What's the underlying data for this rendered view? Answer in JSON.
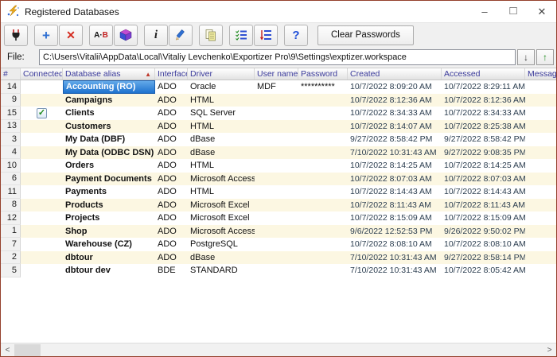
{
  "window": {
    "title": "Registered Databases"
  },
  "icons": {
    "minimize": "–",
    "maximize": "□",
    "close": "✕",
    "plus": "+",
    "delete": "✕",
    "rename_a": "A·",
    "rename_b": "B",
    "info": "i",
    "help": "?",
    "down_arrow": "↓",
    "up_arrow": "↑",
    "scroll_left": "<",
    "scroll_right": ">",
    "sort_ascending": "▲",
    "check": "✓"
  },
  "toolbar": {
    "buttons": [
      {
        "id": "connect",
        "icon": "plug-icon"
      },
      {
        "id": "add",
        "icon": "plus-icon"
      },
      {
        "id": "delete",
        "icon": "delete-x-icon"
      },
      {
        "id": "rename",
        "icon": "rename-ab-icon"
      },
      {
        "id": "database-properties",
        "icon": "database-cube-icon"
      },
      {
        "id": "info",
        "icon": "info-icon"
      },
      {
        "id": "edit",
        "icon": "pencil-icon"
      },
      {
        "id": "copy",
        "icon": "copy-icon"
      },
      {
        "id": "check-list",
        "icon": "checklist-icon"
      },
      {
        "id": "reorder-list",
        "icon": "reorder-icon"
      },
      {
        "id": "help",
        "icon": "help-icon"
      }
    ],
    "clear_passwords_label": "Clear Passwords"
  },
  "file_bar": {
    "label": "File:",
    "path": "C:\\Users\\Vitalii\\AppData\\Local\\Vitaliy Levchenko\\Exportizer Pro\\9\\Settings\\exptizer.workspace"
  },
  "table": {
    "columns": [
      "#",
      "Connected",
      "Database alias",
      "Interface",
      "Driver",
      "User name",
      "Password",
      "Created",
      "Accessed",
      "Message"
    ],
    "sort": {
      "column": "Database alias",
      "direction": "ascending"
    },
    "rows": [
      {
        "num": "14",
        "connected": false,
        "alias": "Accounting (RO)",
        "interface": "ADO",
        "driver": "Oracle",
        "user": "MDF",
        "password": "**********",
        "created": "10/7/2022 8:09:20 AM",
        "accessed": "10/7/2022 8:29:11 AM",
        "message": "",
        "selected": true
      },
      {
        "num": "9",
        "connected": false,
        "alias": "Campaigns",
        "interface": "ADO",
        "driver": "HTML",
        "user": "",
        "password": "",
        "created": "10/7/2022 8:12:36 AM",
        "accessed": "10/7/2022 8:12:36 AM",
        "message": "",
        "selected": false
      },
      {
        "num": "15",
        "connected": true,
        "alias": "Clients",
        "interface": "ADO",
        "driver": "SQL Server",
        "user": "",
        "password": "",
        "created": "10/7/2022 8:34:33 AM",
        "accessed": "10/7/2022 8:34:33 AM",
        "message": "",
        "selected": false
      },
      {
        "num": "13",
        "connected": false,
        "alias": "Customers",
        "interface": "ADO",
        "driver": "HTML",
        "user": "",
        "password": "",
        "created": "10/7/2022 8:14:07 AM",
        "accessed": "10/7/2022 8:25:38 AM",
        "message": "",
        "selected": false
      },
      {
        "num": "3",
        "connected": false,
        "alias": "My Data (DBF)",
        "interface": "ADO",
        "driver": "dBase",
        "user": "",
        "password": "",
        "created": "9/27/2022 8:58:42 PM",
        "accessed": "9/27/2022 8:58:42 PM",
        "message": "",
        "selected": false
      },
      {
        "num": "4",
        "connected": false,
        "alias": "My Data (ODBC DSN)",
        "interface": "ADO",
        "driver": "dBase",
        "user": "",
        "password": "",
        "created": "7/10/2022 10:31:43 AM",
        "accessed": "9/27/2022 9:08:35 PM",
        "message": "",
        "selected": false
      },
      {
        "num": "10",
        "connected": false,
        "alias": "Orders",
        "interface": "ADO",
        "driver": "HTML",
        "user": "",
        "password": "",
        "created": "10/7/2022 8:14:25 AM",
        "accessed": "10/7/2022 8:14:25 AM",
        "message": "",
        "selected": false
      },
      {
        "num": "6",
        "connected": false,
        "alias": "Payment Documents",
        "interface": "ADO",
        "driver": "Microsoft Access",
        "user": "",
        "password": "",
        "created": "10/7/2022 8:07:03 AM",
        "accessed": "10/7/2022 8:07:03 AM",
        "message": "",
        "selected": false
      },
      {
        "num": "11",
        "connected": false,
        "alias": "Payments",
        "interface": "ADO",
        "driver": "HTML",
        "user": "",
        "password": "",
        "created": "10/7/2022 8:14:43 AM",
        "accessed": "10/7/2022 8:14:43 AM",
        "message": "",
        "selected": false
      },
      {
        "num": "8",
        "connected": false,
        "alias": "Products",
        "interface": "ADO",
        "driver": "Microsoft Excel",
        "user": "",
        "password": "",
        "created": "10/7/2022 8:11:43 AM",
        "accessed": "10/7/2022 8:11:43 AM",
        "message": "",
        "selected": false
      },
      {
        "num": "12",
        "connected": false,
        "alias": "Projects",
        "interface": "ADO",
        "driver": "Microsoft Excel",
        "user": "",
        "password": "",
        "created": "10/7/2022 8:15:09 AM",
        "accessed": "10/7/2022 8:15:09 AM",
        "message": "",
        "selected": false
      },
      {
        "num": "1",
        "connected": false,
        "alias": "Shop",
        "interface": "ADO",
        "driver": "Microsoft Access",
        "user": "",
        "password": "",
        "created": "9/6/2022 12:52:53 PM",
        "accessed": "9/26/2022 9:50:02 PM",
        "message": "",
        "selected": false
      },
      {
        "num": "7",
        "connected": false,
        "alias": "Warehouse (CZ)",
        "interface": "ADO",
        "driver": "PostgreSQL",
        "user": "",
        "password": "",
        "created": "10/7/2022 8:08:10 AM",
        "accessed": "10/7/2022 8:08:10 AM",
        "message": "",
        "selected": false
      },
      {
        "num": "2",
        "connected": false,
        "alias": "dbtour",
        "interface": "ADO",
        "driver": "dBase",
        "user": "",
        "password": "",
        "created": "7/10/2022 10:31:43 AM",
        "accessed": "9/27/2022 8:58:14 PM",
        "message": "",
        "selected": false
      },
      {
        "num": "5",
        "connected": false,
        "alias": "dbtour dev",
        "interface": "BDE",
        "driver": "STANDARD",
        "user": "",
        "password": "",
        "created": "7/10/2022 10:31:43 AM",
        "accessed": "10/7/2022 8:05:42 AM",
        "message": "",
        "selected": false
      }
    ]
  },
  "colors": {
    "window_border": "#94402c",
    "row_alt": "#fcf7e2",
    "selected_cell": "#1e72cf",
    "header_text": "#3b3b9c",
    "sort_arrow": "#c0392b"
  }
}
